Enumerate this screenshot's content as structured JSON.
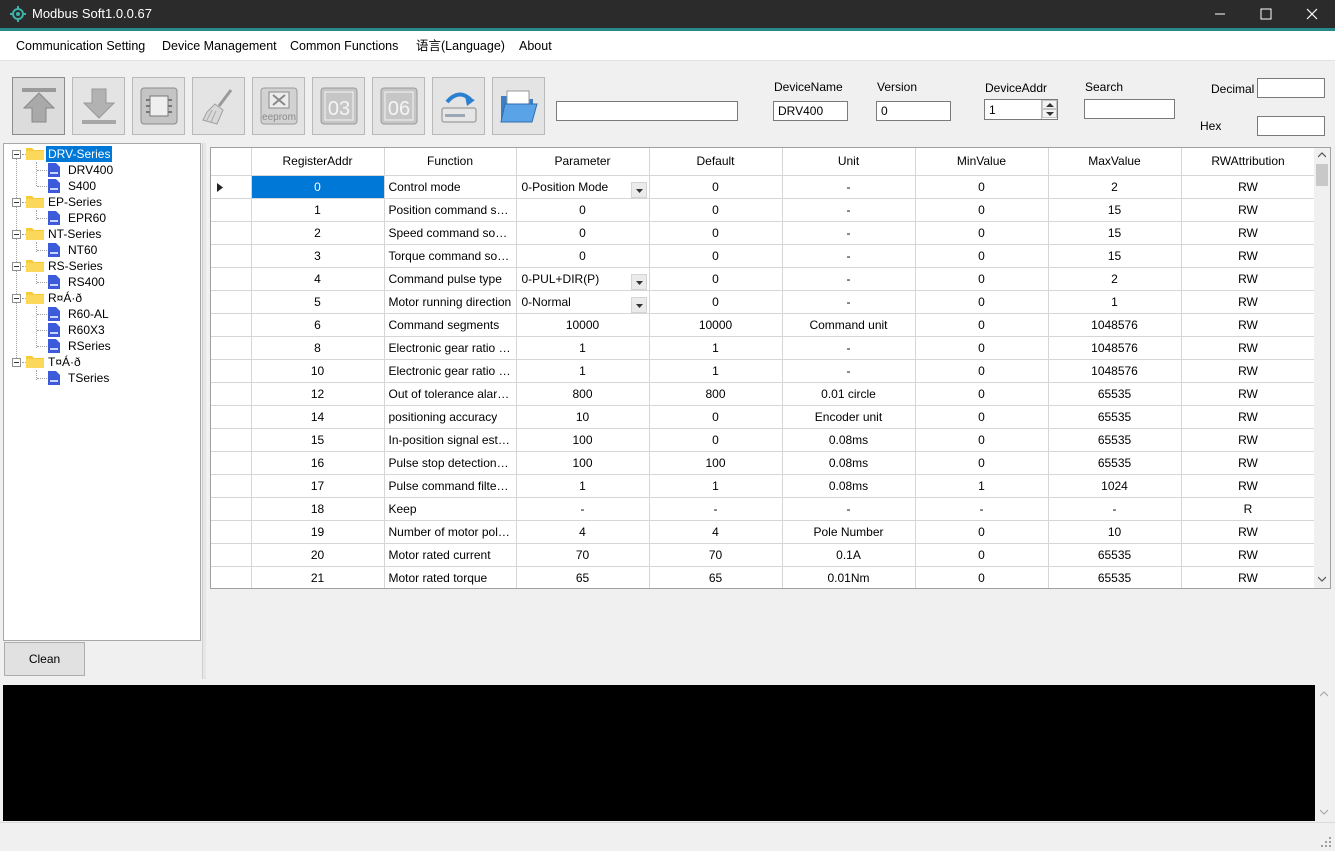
{
  "window": {
    "title": "Modbus Soft1.0.0.67"
  },
  "menu": [
    "Communication Setting",
    "Device Management",
    "Common Functions",
    "语言(Language)",
    "About"
  ],
  "toolbar": {
    "buttons": [
      {
        "name": "upload-button",
        "icon": "upload-arrow-icon"
      },
      {
        "name": "download-button",
        "icon": "download-arrow-icon"
      },
      {
        "name": "chip-button",
        "icon": "chip-icon"
      },
      {
        "name": "clear-brush-button",
        "icon": "brush-icon"
      },
      {
        "name": "eeprom-button",
        "icon": "eeprom-icon",
        "text": "eeprom"
      },
      {
        "name": "function-03-button",
        "icon": "function-03-icon",
        "text": "03"
      },
      {
        "name": "function-06-button",
        "icon": "function-06-icon",
        "text": "06"
      },
      {
        "name": "save-to-drive-button",
        "icon": "save-drive-icon"
      },
      {
        "name": "open-folder-button",
        "icon": "open-folder-icon"
      }
    ],
    "path_value": "",
    "device_name_label": "DeviceName",
    "device_name_value": "DRV400",
    "version_label": "Version",
    "version_value": "0",
    "device_addr_label": "DeviceAddr",
    "device_addr_value": "1",
    "search_label": "Search",
    "search_value": "",
    "decimal_label": "Decimal",
    "decimal_value": "",
    "hex_label": "Hex",
    "hex_value": ""
  },
  "tree": {
    "groups": [
      {
        "label": "DRV-Series",
        "selected": true,
        "children": [
          "DRV400",
          "S400"
        ]
      },
      {
        "label": "EP-Series",
        "children": [
          "EPR60"
        ]
      },
      {
        "label": "NT-Series",
        "children": [
          "NT60"
        ]
      },
      {
        "label": "RS-Series",
        "children": [
          "RS400"
        ]
      },
      {
        "label": "R¤Á·ð",
        "children": [
          "R60-AL",
          "R60X3",
          "RSeries"
        ]
      },
      {
        "label": "T¤Á·ð",
        "children": [
          "TSeries"
        ]
      }
    ],
    "clean_label": "Clean"
  },
  "grid": {
    "columns": [
      "RegisterAddr",
      "Function",
      "Parameter",
      "Default",
      "Unit",
      "MinValue",
      "MaxValue",
      "RWAttribution"
    ],
    "rows": [
      {
        "addr": "0",
        "func": "Control mode",
        "param": "0-Position Mode",
        "combo": true,
        "def": "0",
        "unit": "-",
        "min": "0",
        "max": "2",
        "rw": "RW"
      },
      {
        "addr": "1",
        "func": "Position command source",
        "param": "0",
        "def": "0",
        "unit": "-",
        "min": "0",
        "max": "15",
        "rw": "RW"
      },
      {
        "addr": "2",
        "func": "Speed command source",
        "param": "0",
        "def": "0",
        "unit": "-",
        "min": "0",
        "max": "15",
        "rw": "RW"
      },
      {
        "addr": "3",
        "func": "Torque command source",
        "param": "0",
        "def": "0",
        "unit": "-",
        "min": "0",
        "max": "15",
        "rw": "RW"
      },
      {
        "addr": "4",
        "func": "Command pulse type",
        "param": "0-PUL+DIR(P)",
        "combo": true,
        "def": "0",
        "unit": "-",
        "min": "0",
        "max": "2",
        "rw": "RW"
      },
      {
        "addr": "5",
        "func": "Motor running direction",
        "param": "0-Normal",
        "combo": true,
        "def": "0",
        "unit": "-",
        "min": "0",
        "max": "1",
        "rw": "RW"
      },
      {
        "addr": "6",
        "func": "Command segments",
        "param": "10000",
        "def": "10000",
        "unit": "Command unit",
        "min": "0",
        "max": "1048576",
        "rw": "RW"
      },
      {
        "addr": "8",
        "func": "Electronic gear ratio nu...",
        "param": "1",
        "def": "1",
        "unit": "-",
        "min": "0",
        "max": "1048576",
        "rw": "RW"
      },
      {
        "addr": "10",
        "func": "Electronic gear ratio de...",
        "param": "1",
        "def": "1",
        "unit": "-",
        "min": "0",
        "max": "1048576",
        "rw": "RW"
      },
      {
        "addr": "12",
        "func": "Out of tolerance alarm t...",
        "param": "800",
        "def": "800",
        "unit": "0.01 circle",
        "min": "0",
        "max": "65535",
        "rw": "RW"
      },
      {
        "addr": "14",
        "func": "positioning accuracy",
        "param": "10",
        "def": "0",
        "unit": "Encoder unit",
        "min": "0",
        "max": "65535",
        "rw": "RW"
      },
      {
        "addr": "15",
        "func": "In-position signal establi...",
        "param": "100",
        "def": "0",
        "unit": "0.08ms",
        "min": "0",
        "max": "65535",
        "rw": "RW"
      },
      {
        "addr": "16",
        "func": "Pulse stop detection time",
        "param": "100",
        "def": "100",
        "unit": "0.08ms",
        "min": "0",
        "max": "65535",
        "rw": "RW"
      },
      {
        "addr": "17",
        "func": "Pulse command filter time",
        "param": "1",
        "def": "1",
        "unit": "0.08ms",
        "min": "1",
        "max": "1024",
        "rw": "RW"
      },
      {
        "addr": "18",
        "func": "Keep",
        "param": "-",
        "def": "-",
        "unit": "-",
        "min": "-",
        "max": "-",
        "rw": "R"
      },
      {
        "addr": "19",
        "func": "Number of motor pole p...",
        "param": "4",
        "def": "4",
        "unit": "Pole Number",
        "min": "0",
        "max": "10",
        "rw": "RW"
      },
      {
        "addr": "20",
        "func": "Motor rated current",
        "param": "70",
        "def": "70",
        "unit": "0.1A",
        "min": "0",
        "max": "65535",
        "rw": "RW"
      },
      {
        "addr": "21",
        "func": "Motor rated torque",
        "param": "65",
        "def": "65",
        "unit": "0.01Nm",
        "min": "0",
        "max": "65535",
        "rw": "RW"
      }
    ]
  },
  "console": {
    "text": ""
  },
  "colors": {
    "title_bg": "#2b2b2b",
    "accent": "#2a8a8a",
    "selection": "#0078d7",
    "console_bg": "#000000"
  }
}
